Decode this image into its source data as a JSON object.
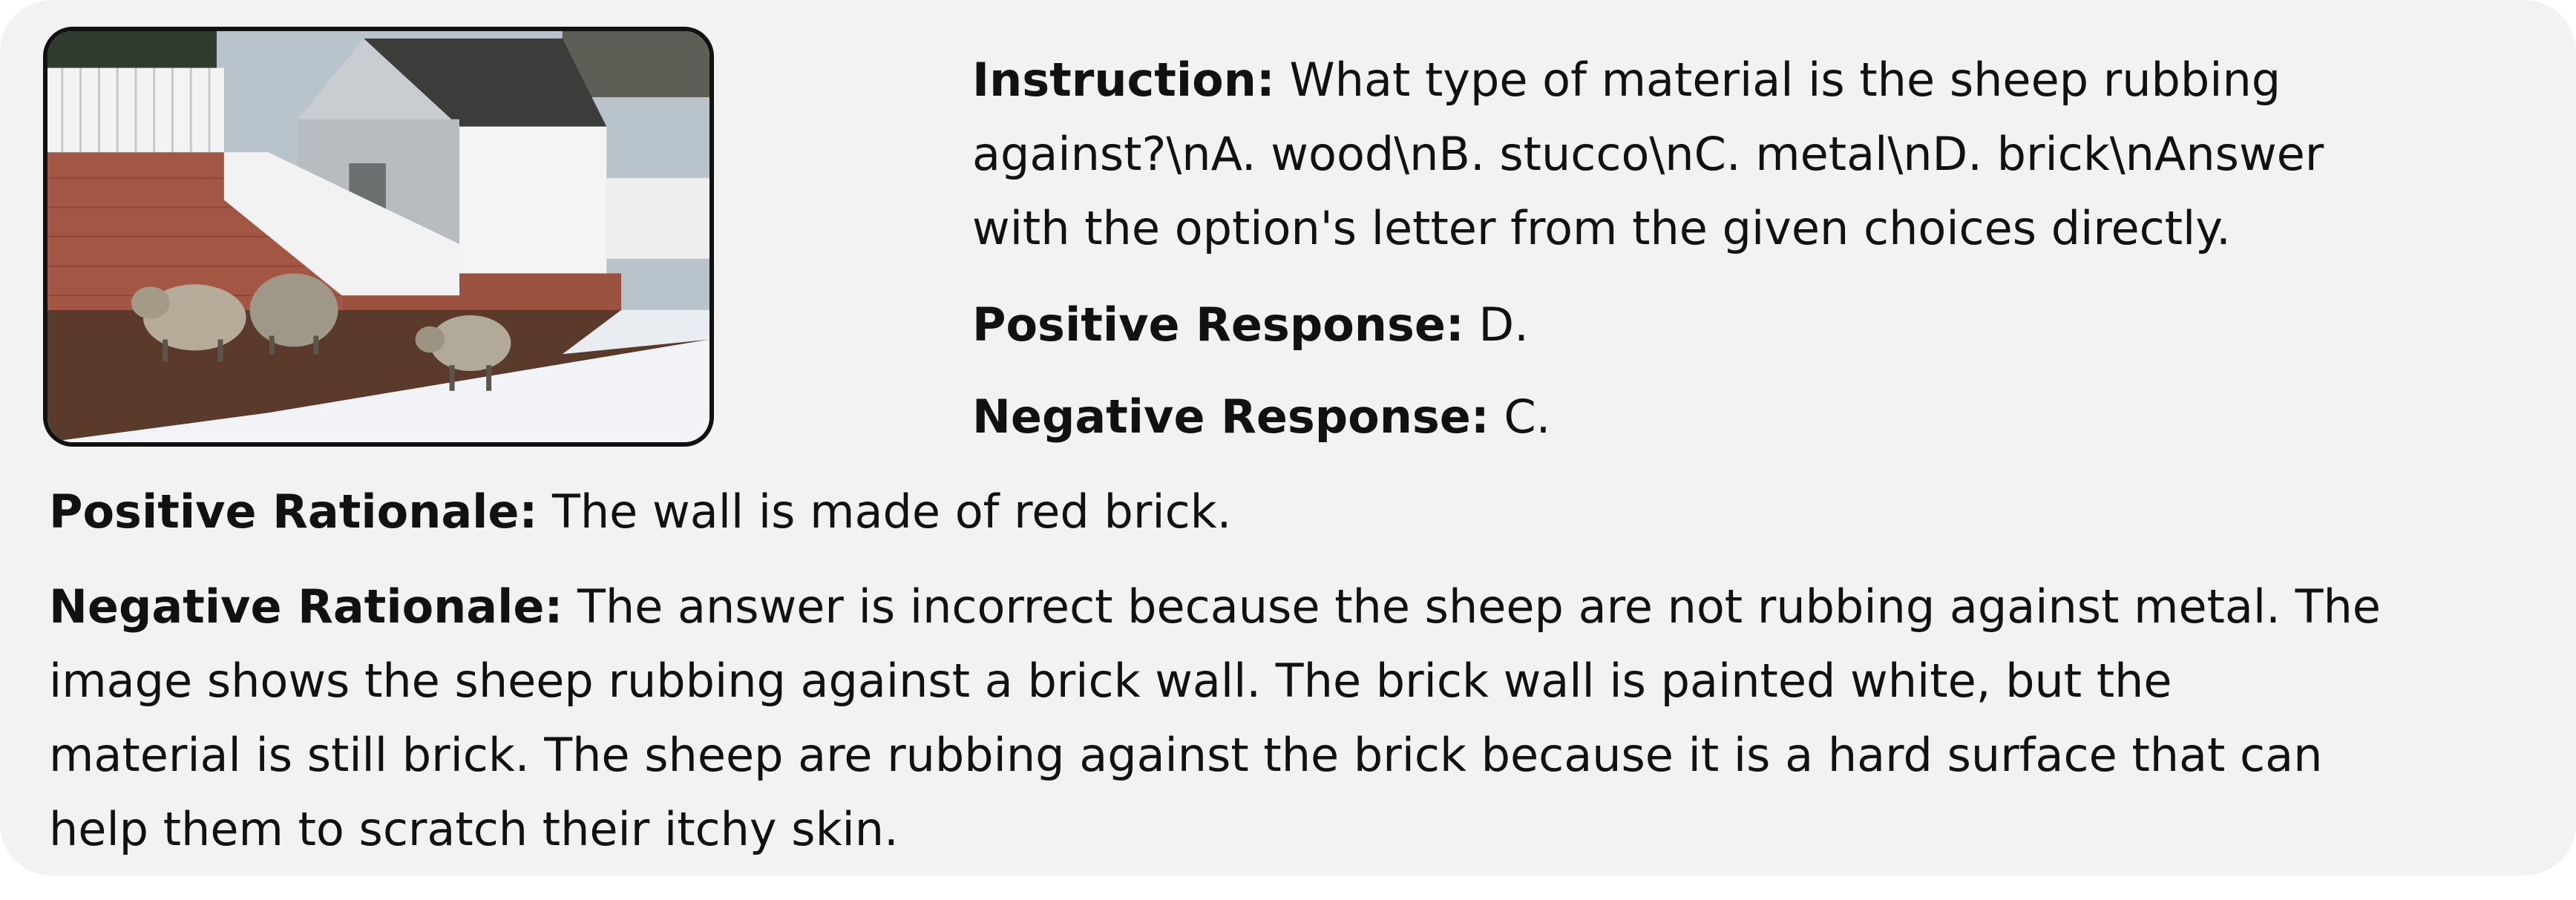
{
  "instruction": {
    "label": "Instruction:",
    "line1": "What type of material is the sheep rubbing",
    "line2": "against?\\nA. wood\\nB. stucco\\nC. metal\\nD. brick\\nAnswer",
    "line3": "with the option's letter from the given choices directly."
  },
  "positive_response": {
    "label": "Positive Response:",
    "text": "D."
  },
  "negative_response": {
    "label": "Negative Response:",
    "text": "C."
  },
  "positive_rationale": {
    "label": "Positive Rationale:",
    "text": "The wall is made of red brick."
  },
  "negative_rationale": {
    "label": "Negative Rationale:",
    "line1": "The answer is incorrect because the sheep are not rubbing against metal. The",
    "line2": "image shows the sheep rubbing against a brick wall. The brick wall is painted white, but the",
    "line3": "material is still brick. The sheep are rubbing against the brick because it is a hard surface that can",
    "line4": "help them to scratch their itchy skin."
  }
}
